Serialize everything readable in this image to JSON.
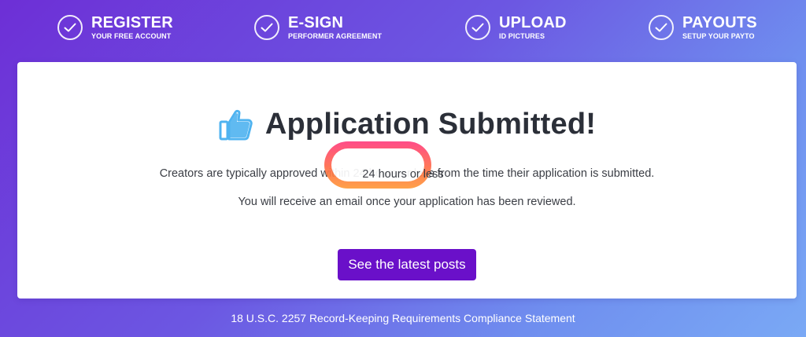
{
  "steps": [
    {
      "title": "REGISTER",
      "subtitle": "YOUR FREE ACCOUNT",
      "icon": "check-icon"
    },
    {
      "title": "E-SIGN",
      "subtitle": "PERFORMER AGREEMENT",
      "icon": "check-icon"
    },
    {
      "title": "UPLOAD",
      "subtitle": "ID PICTURES",
      "icon": "check-icon"
    },
    {
      "title": "PAYOUTS",
      "subtitle": "SETUP YOUR PAYTO",
      "icon": "check-icon"
    }
  ],
  "card": {
    "headline": "Application Submitted!",
    "headline_icon": "thumbs-up-icon",
    "line1": "Creators are typically approved within 24 hours or less from the time their application is submitted.",
    "line2": "You will receive an email once your application has been reviewed.",
    "highlighted_text": "24 hours or less",
    "cta_label": "See the latest posts"
  },
  "footer": {
    "compliance_link": "18 U.S.C. 2257 Record-Keeping Requirements Compliance Statement"
  },
  "colors": {
    "accent": "#6a10c9",
    "highlight": "#ff5a6a",
    "thumb": "#4fb3f0"
  }
}
